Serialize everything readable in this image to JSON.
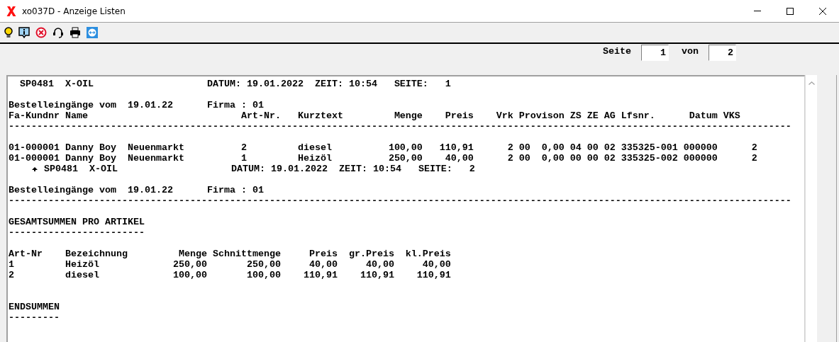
{
  "window": {
    "title": "xo037D - Anzeige Listen"
  },
  "pager": {
    "label": "Seite",
    "page": "1",
    "of_label": "von",
    "total": "2"
  },
  "report": {
    "lines": [
      {
        "kind": "text",
        "text": "  SP0481  X-OIL                    DATUM: 19.01.2022  ZEIT: 10:54   SEITE:   1"
      },
      {
        "kind": "blank"
      },
      {
        "kind": "text",
        "text": "Bestelleingänge vom  19.01.22      Firma : 01"
      },
      {
        "kind": "text",
        "text": "Fa-Kundnr Name                           Art-Nr.   Kurztext         Menge    Preis    Vrk Provison ZS ZE AG Lfsnr.      Datum VKS"
      },
      {
        "kind": "rule",
        "text": "------------------------------------------------------------------------------------------------------------------------------------------"
      },
      {
        "kind": "blank"
      },
      {
        "kind": "text",
        "text": "01-000001 Danny Boy  Neuenmarkt          2         diesel          100,00   110,91      2 00  0,00 04 00 02 335325-001 000000      2"
      },
      {
        "kind": "text",
        "text": "01-000001 Danny Boy  Neuenmarkt          1         Heizöl          250,00    40,00      2 00  0,00 00 00 02 335325-002 000000      2"
      },
      {
        "kind": "marker",
        "text": "SP0481  X-OIL                    DATUM: 19.01.2022  ZEIT: 10:54   SEITE:   2"
      },
      {
        "kind": "blank"
      },
      {
        "kind": "text",
        "text": "Bestelleingänge vom  19.01.22      Firma : 01"
      },
      {
        "kind": "rule",
        "text": "------------------------------------------------------------------------------------------------------------------------------------------"
      },
      {
        "kind": "blank"
      },
      {
        "kind": "text",
        "text": "GESAMTSUMMEN PRO ARTIKEL"
      },
      {
        "kind": "rule",
        "text": "------------------------"
      },
      {
        "kind": "blank"
      },
      {
        "kind": "text",
        "text": "Art-Nr    Bezeichnung         Menge Schnittmenge     Preis  gr.Preis  kl.Preis"
      },
      {
        "kind": "text",
        "text": "1         Heizöl             250,00       250,00     40,00     40,00     40,00"
      },
      {
        "kind": "text",
        "text": "2         diesel             100,00       100,00    110,91    110,91    110,91"
      },
      {
        "kind": "blank"
      },
      {
        "kind": "blank"
      },
      {
        "kind": "text",
        "text": "ENDSUMMEN"
      },
      {
        "kind": "rule",
        "text": "---------"
      }
    ]
  }
}
